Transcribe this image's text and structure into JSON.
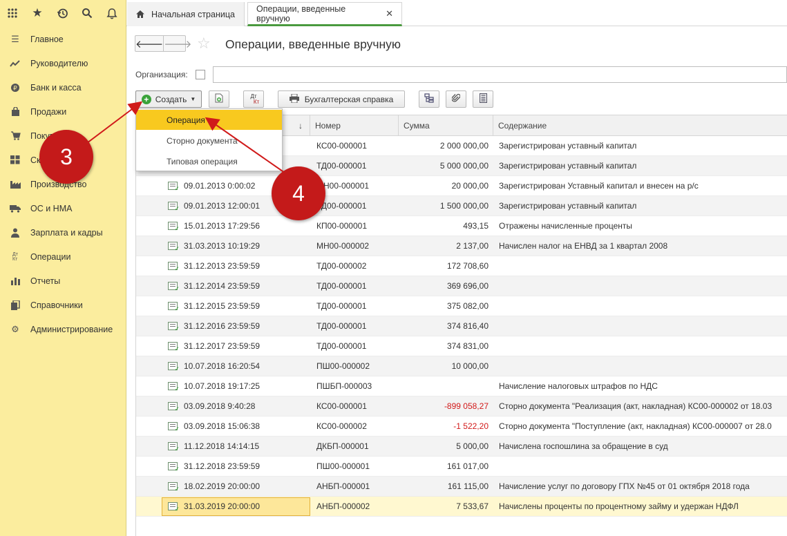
{
  "top": {
    "icons": [
      "grid-icon",
      "star-icon",
      "history-icon",
      "search-icon",
      "bell-icon"
    ],
    "tabs": [
      {
        "label": "Начальная страница"
      },
      {
        "label": "Операции, введенные вручную"
      }
    ]
  },
  "sidebar": {
    "items": [
      {
        "label": "Главное",
        "icon": "menu-icon"
      },
      {
        "label": "Руководителю",
        "icon": "trend-icon"
      },
      {
        "label": "Банк и касса",
        "icon": "coin-icon"
      },
      {
        "label": "Продажи",
        "icon": "bag-icon"
      },
      {
        "label": "Покупки",
        "icon": "cart-icon"
      },
      {
        "label": "Склад",
        "icon": "warehouse-icon"
      },
      {
        "label": "Производство",
        "icon": "factory-icon"
      },
      {
        "label": "ОС и НМА",
        "icon": "truck-icon"
      },
      {
        "label": "Зарплата и кадры",
        "icon": "person-icon"
      },
      {
        "label": "Операции",
        "icon": "dt-kt-icon"
      },
      {
        "label": "Отчеты",
        "icon": "chart-icon"
      },
      {
        "label": "Справочники",
        "icon": "books-icon"
      },
      {
        "label": "Администрирование",
        "icon": "gear-icon"
      }
    ]
  },
  "page": {
    "title": "Операции, введенные вручную",
    "org_label": "Организация:"
  },
  "toolbar": {
    "create_label": "Создать",
    "dtkt_top": "Дт",
    "dtkt_bottom": "Кт",
    "report_label": "Бухгалтерская справка"
  },
  "dropdown": {
    "items": [
      "Операция",
      "Сторно документа",
      "Типовая операция"
    ]
  },
  "table": {
    "headers": {
      "sort": "↓",
      "number": "Номер",
      "sum": "Сумма",
      "content": "Содержание"
    },
    "rows": [
      {
        "date": "",
        "number": "КС00-000001",
        "sum": "2 000 000,00",
        "text": "Зарегистрирован уставный капитал"
      },
      {
        "date": "",
        "number": "ТД00-000001",
        "sum": "5 000 000,00",
        "text": "Зарегистрирован уставный капитал"
      },
      {
        "date": "09.01.2013 0:00:02",
        "number": "МН00-000001",
        "sum": "20 000,00",
        "text": "Зарегистрирован Уставный капитал и внесен на р/с"
      },
      {
        "date": "09.01.2013 12:00:01",
        "number": "ТД00-000001",
        "sum": "1 500 000,00",
        "text": "Зарегистрирован уставный капитал"
      },
      {
        "date": "15.01.2013 17:29:56",
        "number": "КП00-000001",
        "sum": "493,15",
        "text": "Отражены начисленные проценты"
      },
      {
        "date": "31.03.2013 10:19:29",
        "number": "МН00-000002",
        "sum": "2 137,00",
        "text": "Начислен налог на ЕНВД за 1 квартал 2008"
      },
      {
        "date": "31.12.2013 23:59:59",
        "number": "ТД00-000002",
        "sum": "172 708,60",
        "text": ""
      },
      {
        "date": "31.12.2014 23:59:59",
        "number": "ТД00-000001",
        "sum": "369 696,00",
        "text": ""
      },
      {
        "date": "31.12.2015 23:59:59",
        "number": "ТД00-000001",
        "sum": "375 082,00",
        "text": ""
      },
      {
        "date": "31.12.2016 23:59:59",
        "number": "ТД00-000001",
        "sum": "374 816,40",
        "text": ""
      },
      {
        "date": "31.12.2017 23:59:59",
        "number": "ТД00-000001",
        "sum": "374 831,00",
        "text": ""
      },
      {
        "date": "10.07.2018 16:20:54",
        "number": "ПШ00-000002",
        "sum": "10 000,00",
        "text": ""
      },
      {
        "date": "10.07.2018 19:17:25",
        "number": "ПШБП-000003",
        "sum": "",
        "text": "Начисление налоговых штрафов по НДС"
      },
      {
        "date": "03.09.2018 9:40:28",
        "number": "КС00-000001",
        "sum": "-899 058,27",
        "text": "Сторно документа \"Реализация (акт, накладная) КС00-000002 от 18.03",
        "negative": true
      },
      {
        "date": "03.09.2018 15:06:38",
        "number": "КС00-000002",
        "sum": "-1 522,20",
        "text": "Сторно документа \"Поступление (акт, накладная) КС00-000007 от 28.0",
        "negative": true
      },
      {
        "date": "11.12.2018 14:14:15",
        "number": "ДКБП-000001",
        "sum": "5 000,00",
        "text": "Начислена госпошлина за обращение в суд"
      },
      {
        "date": "31.12.2018 23:59:59",
        "number": "ПШ00-000001",
        "sum": "161 017,00",
        "text": ""
      },
      {
        "date": "18.02.2019 20:00:00",
        "number": "АНБП-000001",
        "sum": "161 115,00",
        "text": "Начисление услуг по договору ГПХ №45 от 01 октября 2018 года"
      },
      {
        "date": "31.03.2019 20:00:00",
        "number": "АНБП-000002",
        "sum": "7 533,67",
        "text": "Начислены проценты по процентному займу и удержан НДФЛ",
        "selected": true
      }
    ]
  },
  "annotations": [
    {
      "label": "3",
      "color": "#c41a1a"
    },
    {
      "label": "4",
      "color": "#c41a1a"
    }
  ]
}
